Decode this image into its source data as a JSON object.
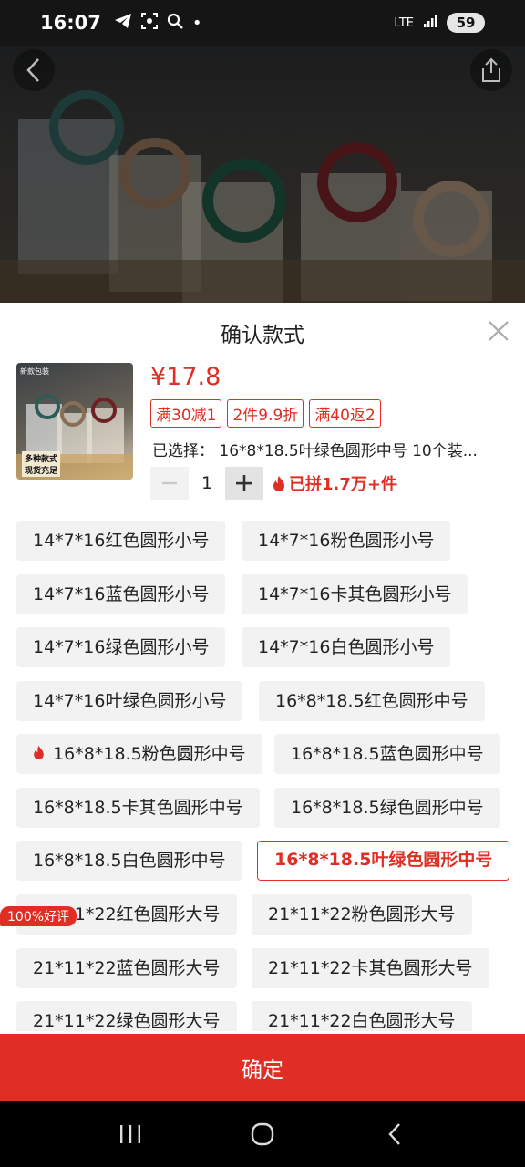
{
  "status_bar": {
    "time": "16:07",
    "network": "LTE",
    "battery": "59"
  },
  "sheet": {
    "title": "确认款式",
    "price": "¥17.8",
    "promos": [
      "满30减1",
      "2件9.9折",
      "满40返2"
    ],
    "selected_text": "已选择： 16*8*18.5叶绿色圆形中号 10个装...",
    "quantity": "1",
    "joined_text": "已拼1.7万+件",
    "thumb_tag": "新款包装",
    "thumb_caption_1": "多种款式",
    "thumb_caption_2": "现货充足",
    "rating_badge": "100%好评",
    "options": [
      "14*7*16红色圆形小号",
      "14*7*16粉色圆形小号",
      "14*7*16蓝色圆形小号",
      "14*7*16卡其色圆形小号",
      "14*7*16绿色圆形小号",
      "14*7*16白色圆形小号",
      "14*7*16叶绿色圆形小号",
      "16*8*18.5红色圆形中号",
      "16*8*18.5粉色圆形中号",
      "16*8*18.5蓝色圆形中号",
      "16*8*18.5卡其色圆形中号",
      "16*8*18.5绿色圆形中号",
      "16*8*18.5白色圆形中号",
      "16*8*18.5叶绿色圆形中号",
      "21*11*22红色圆形大号",
      "21*11*22粉色圆形大号",
      "21*11*22蓝色圆形大号",
      "21*11*22卡其色圆形大号",
      "21*11*22绿色圆形大号",
      "21*11*22白色圆形大号"
    ],
    "selected_option": "16*8*18.5叶绿色圆形中号",
    "confirm_label": "确定"
  },
  "colors": {
    "accent": "#e02e24",
    "option_bg": "#f2f2f2"
  }
}
